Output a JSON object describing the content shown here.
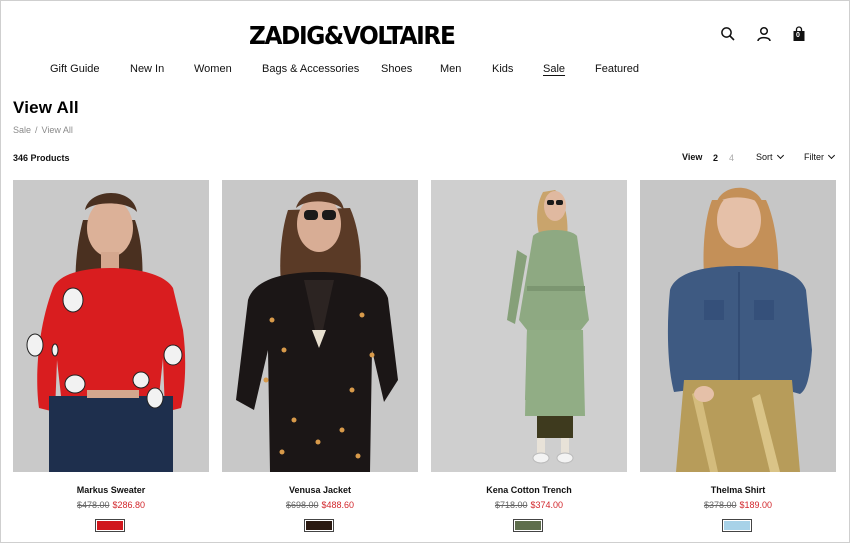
{
  "brand": "ZADIG&VOLTAIRE",
  "header_icons": [
    "search-icon",
    "account-icon",
    "cart-icon"
  ],
  "cart_count": "0",
  "nav": [
    "Gift Guide",
    "New In",
    "Women",
    "Bags & Accessories",
    "Shoes",
    "Men",
    "Kids",
    "Sale",
    "Featured"
  ],
  "nav_active": "Sale",
  "page_title": "View All",
  "breadcrumb": [
    "Sale",
    "View All"
  ],
  "product_count": "346 Products",
  "toolbar": {
    "view_label": "View",
    "view_options": [
      "2",
      "4"
    ],
    "view_selected": "2",
    "sort_label": "Sort",
    "filter_label": "Filter"
  },
  "products": [
    {
      "name": "Markus Sweater",
      "old_price": "$478.00",
      "new_price": "$286.80",
      "swatch": "#d0161c"
    },
    {
      "name": "Venusa Jacket",
      "old_price": "$698.00",
      "new_price": "$488.60",
      "swatch": "#2b1a12"
    },
    {
      "name": "Kena Cotton Trench",
      "old_price": "$718.00",
      "new_price": "$374.00",
      "swatch": "#5e6e4c"
    },
    {
      "name": "Thelma Shirt",
      "old_price": "$378.00",
      "new_price": "$189.00",
      "swatch": "#a8d2e8"
    }
  ],
  "colors": {
    "sale_price": "#d2272c",
    "photo_background": "#c9c9c9"
  }
}
